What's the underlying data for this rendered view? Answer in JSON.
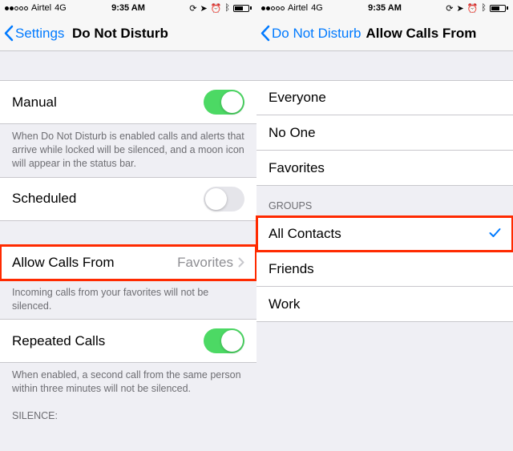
{
  "statusbar": {
    "carrier": "Airtel",
    "network": "4G",
    "time": "9:35 AM"
  },
  "left": {
    "back": "Settings",
    "title": "Do Not Disturb",
    "rows": {
      "manual": "Manual",
      "manual_footer": "When Do Not Disturb is enabled calls and alerts that arrive while locked will be silenced, and a moon icon will appear in the status bar.",
      "scheduled": "Scheduled",
      "allow": "Allow Calls From",
      "allow_value": "Favorites",
      "allow_footer": "Incoming calls from your favorites will not be silenced.",
      "repeated": "Repeated Calls",
      "repeated_footer": "When enabled, a second call from the same person within three minutes will not be silenced.",
      "silence_header": "SILENCE:"
    },
    "toggles": {
      "manual": true,
      "scheduled": false,
      "repeated": true
    }
  },
  "right": {
    "back": "Do Not Disturb",
    "title": "Allow Calls From",
    "rows": {
      "everyone": "Everyone",
      "noone": "No One",
      "favorites": "Favorites",
      "groups_header": "GROUPS",
      "all_contacts": "All Contacts",
      "friends": "Friends",
      "work": "Work"
    },
    "selected": "all_contacts"
  }
}
